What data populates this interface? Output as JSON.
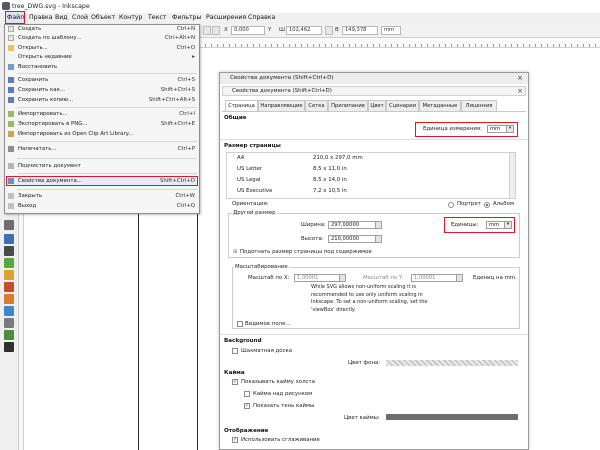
{
  "app": {
    "title": "tree_DWG.svg - Inkscape",
    "menu": [
      "Файл",
      "Правка",
      "Вид",
      "Слой",
      "Объект",
      "Контур",
      "Текст",
      "Фильтры",
      "Расширения",
      "Справка"
    ]
  },
  "toolbar": {
    "x_label": "X",
    "x_value": "0,000",
    "y_label": "Y",
    "w_label": "Ш",
    "w_value": "102,462",
    "h_label": "В",
    "h_value": "149,378",
    "unit": "mm"
  },
  "file_menu": {
    "items": [
      {
        "label": "Создать",
        "shortcut": "Ctrl+N"
      },
      {
        "label": "Создать по шаблону...",
        "shortcut": "Ctrl+Alt+N"
      },
      {
        "label": "Открыть...",
        "shortcut": "Ctrl+O"
      },
      {
        "label": "Открыть недавние",
        "shortcut": "▸"
      },
      {
        "label": "Восстановить",
        "shortcut": ""
      },
      {
        "label": "Сохранить",
        "shortcut": "Ctrl+S"
      },
      {
        "label": "Сохранить как...",
        "shortcut": "Shift+Ctrl+S"
      },
      {
        "label": "Сохранить копию...",
        "shortcut": "Shift+Ctrl+Alt+S"
      },
      {
        "label": "Импортировать...",
        "shortcut": "Ctrl+I"
      },
      {
        "label": "Экспортировать в PNG...",
        "shortcut": "Shift+Ctrl+E"
      },
      {
        "label": "Импортировать из Open Clip Art Library...",
        "shortcut": ""
      },
      {
        "label": "Напечатать...",
        "shortcut": "Ctrl+P"
      },
      {
        "label": "Подчистить документ",
        "shortcut": ""
      },
      {
        "label": "Свойства документа...",
        "shortcut": "Shift+Ctrl+D"
      },
      {
        "label": "Закрыть",
        "shortcut": "Ctrl+W"
      },
      {
        "label": "Выход",
        "shortcut": "Ctrl+Q"
      }
    ]
  },
  "dialog": {
    "window_title": "Свойства документа (Shift+Ctrl+D)",
    "panel_title": "Свойства документа (Shift+Ctrl+D)",
    "close_label": "×",
    "tabs": [
      "Страница",
      "Направляющие",
      "Сетка",
      "Прилипание",
      "Цвет",
      "Сценарии",
      "Метаданные",
      "Лицензия"
    ],
    "general": {
      "heading": "Общие",
      "display_units_label": "Единица измерения:",
      "display_units_value": "mm"
    },
    "page_size": {
      "heading": "Размер страницы",
      "rows": [
        {
          "name": "A4",
          "size": "210,0 x 297,0 mm"
        },
        {
          "name": "US Letter",
          "size": "8,5 x 11,0 in"
        },
        {
          "name": "US Legal",
          "size": "8,5 x 14,0 in"
        },
        {
          "name": "US Executive",
          "size": "7,2 x 10,5 in"
        }
      ],
      "orientation_label": "Ориентация:",
      "portrait_label": "Портрет",
      "landscape_label": "Альбом"
    },
    "custom_size": {
      "heading": "Другой размер",
      "width_label": "Ширина:",
      "width_value": "297,00000",
      "height_label": "Высота:",
      "height_value": "210,00000",
      "units_label": "Единицы:",
      "units_value": "mm",
      "fit_label": "Подогнать размер страницы под содержимое"
    },
    "scale": {
      "heading": "Масштабирование",
      "scale_x_label": "Масштаб по X:",
      "scale_x_value": "1,00001",
      "scale_y_label": "Масштаб по Y:",
      "scale_y_value": "1,00001",
      "user_units_label": "Единиц на mm.",
      "note": "While SVG allows non-uniform scaling it is recommended to use only uniform scaling in Inkscape. To set a non-uniform scaling, set the 'viewBox' directly.",
      "viewbox_label": "Видимое поле..."
    },
    "background": {
      "heading": "Background",
      "checkerboard_label": "Шахматная доска",
      "bg_color_label": "Цвет фона:"
    },
    "border": {
      "heading": "Кайма",
      "show_border_label": "Показывать кайму холста",
      "border_on_top_label": "Кайма над рисунком",
      "show_shadow_label": "Показать тень каймы",
      "border_color_label": "Цвет каймы:"
    },
    "display": {
      "heading": "Отображение",
      "antialias_label": "Использовать сглаживание"
    }
  },
  "colors": {
    "highlight_red": "#e0162b",
    "menu_bg": "#f5f5f5",
    "dialog_bg": "#ffffff",
    "checkbox_blue": "#1a4f9a"
  }
}
